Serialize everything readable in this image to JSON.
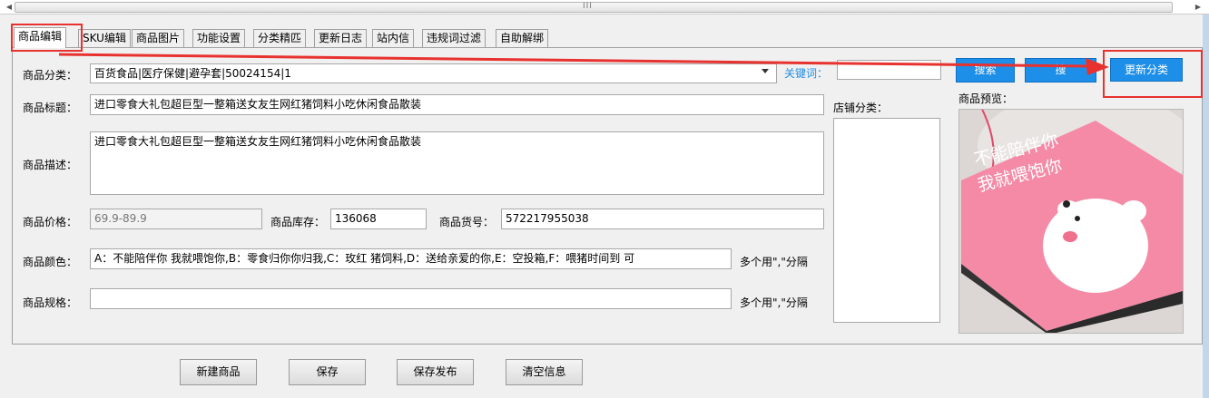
{
  "scrollbar": {
    "grip": "III"
  },
  "tabs": [
    {
      "label": "商品编辑",
      "active": true
    },
    {
      "label": "SKU编辑"
    },
    {
      "label": "商品图片"
    },
    {
      "label": "功能设置"
    },
    {
      "label": "分类精匹"
    },
    {
      "label": "更新日志"
    },
    {
      "label": "站内信"
    },
    {
      "label": "违规词过滤"
    },
    {
      "label": "自助解绑"
    }
  ],
  "form": {
    "category_label": "商品分类：",
    "category_value": "百货食品|医疗保健|避孕套|50024154|1",
    "keyword_label": "关键词：",
    "keyword_value": "",
    "search_btn_1": "搜索",
    "search_btn_2": "搜",
    "update_category_btn": "更新分类",
    "preview_label": "商品预览：",
    "title_label": "商品标题：",
    "title_value": "进口零食大礼包超巨型一整箱送女友生网红猪饲料小吃休闲食品散装",
    "store_category_label": "店铺分类：",
    "desc_label": "商品描述：",
    "desc_value": "进口零食大礼包超巨型一整箱送女友生网红猪饲料小吃休闲食品散装",
    "price_label": "商品价格：",
    "price_value": "69.9-89.9",
    "stock_label": "商品库存：",
    "stock_value": "136068",
    "sku_no_label": "商品货号：",
    "sku_no_value": "572217955038",
    "color_label": "商品颜色：",
    "color_value": "A：不能陪伴你 我就喂饱你,B：零食归你你归我,C：玫红 猪饲料,D：送给亲爱的你,E：空投箱,F：喂猪时间到 可",
    "color_hint": "多个用\",\"分隔",
    "spec_label": "商品规格：",
    "spec_value": "",
    "spec_hint": "多个用\",\"分隔"
  },
  "preview_image": {
    "line1": "不能陪伴你",
    "line2": "我就喂饱你"
  },
  "buttons": {
    "new": "新建商品",
    "save": "保存",
    "save_publish": "保存发布",
    "clear": "清空信息"
  },
  "colors": {
    "accent_blue": "#1e8fe8",
    "highlight_red": "#e8322f",
    "box_pink": "#f48aa6"
  }
}
